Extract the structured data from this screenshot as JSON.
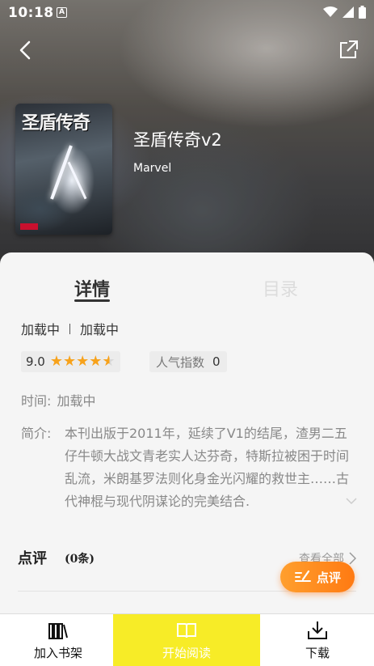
{
  "status_bar": {
    "time": "10:18",
    "notification": "A"
  },
  "book": {
    "title": "圣盾传奇v2",
    "author": "Marvel",
    "cover_title": "圣盾传奇"
  },
  "tabs": [
    {
      "label": "详情",
      "active": true
    },
    {
      "label": "目录",
      "active": false
    }
  ],
  "details": {
    "status_a": "加载中",
    "status_b": "加载中",
    "score": "9.0",
    "stars": 4.5,
    "popularity_label": "人气指数",
    "popularity_value": "0",
    "time_label": "时间:",
    "time_value": "加载中",
    "intro_label": "简介:",
    "intro_text": "本刊出版于2011年，延续了V1的结尾，渣男二五仔牛顿大战文青老实人达芬奇，特斯拉被困于时间乱流，米朗基罗法则化身金光闪耀的救世主……古代神棍与现代阴谋论的完美结合."
  },
  "reviews": {
    "title": "点评",
    "count": "(0条)",
    "see_all": "查看全部",
    "comment_button": "点评"
  },
  "bottom_bar": {
    "add_shelf": "加入书架",
    "start_read": "开始阅读",
    "download": "下载"
  },
  "colors": {
    "accent_yellow": "#f7ec27",
    "star": "#f7a21b",
    "comment_orange": "#ff8a1e"
  }
}
